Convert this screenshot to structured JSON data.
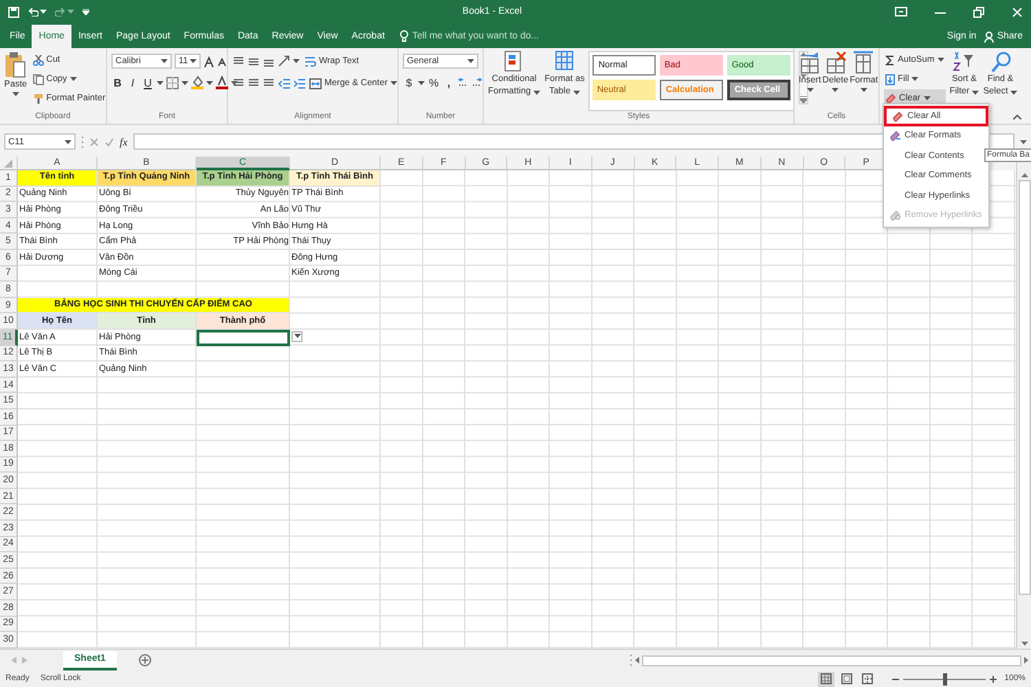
{
  "title_bar": {
    "title": "Book1 - Excel"
  },
  "tabs": [
    {
      "label": "File",
      "selected": false
    },
    {
      "label": "Home",
      "selected": true
    },
    {
      "label": "Insert",
      "selected": false
    },
    {
      "label": "Page Layout",
      "selected": false
    },
    {
      "label": "Formulas",
      "selected": false
    },
    {
      "label": "Data",
      "selected": false
    },
    {
      "label": "Review",
      "selected": false
    },
    {
      "label": "View",
      "selected": false
    },
    {
      "label": "Acrobat",
      "selected": false
    }
  ],
  "tell_me": {
    "placeholder": "Tell me what you want to do..."
  },
  "account": {
    "sign_in": "Sign in",
    "share": "Share"
  },
  "ribbon": {
    "clipboard": {
      "label": "Clipboard",
      "paste": "Paste",
      "cut": "Cut",
      "copy": "Copy",
      "format_painter": "Format Painter"
    },
    "font": {
      "label": "Font",
      "family": "Calibri",
      "size": "11",
      "bold": "B",
      "italic": "I",
      "underline": "U"
    },
    "alignment": {
      "label": "Alignment",
      "wrap_text": "Wrap Text",
      "merge": "Merge & Center"
    },
    "number": {
      "label": "Number",
      "format": "General",
      "currency": "$",
      "percent": "%",
      "comma": ","
    },
    "styles": {
      "label": "Styles",
      "conditional": [
        "Conditional",
        "Formatting"
      ],
      "format_table": [
        "Format as",
        "Table"
      ],
      "cell_styles": [
        {
          "name": "Normal",
          "kind": "normal"
        },
        {
          "name": "Bad",
          "kind": "bad"
        },
        {
          "name": "Good",
          "kind": "good"
        },
        {
          "name": "Neutral",
          "kind": "neutral"
        },
        {
          "name": "Calculation",
          "kind": "calculation"
        },
        {
          "name": "Check Cell",
          "kind": "check"
        }
      ]
    },
    "cells": {
      "label": "Cells",
      "buttons": [
        {
          "label": "Insert",
          "kind": "insert"
        },
        {
          "label": "Delete",
          "kind": "delete"
        },
        {
          "label": "Format",
          "kind": "format"
        }
      ]
    },
    "editing": {
      "autosum": "AutoSum",
      "fill": "Fill",
      "clear": {
        "label": "Clear",
        "expanded": true
      },
      "sort": [
        "Sort &",
        "Filter"
      ],
      "find": [
        "Find &",
        "Select"
      ]
    }
  },
  "formula_bar": {
    "name_box": "C11",
    "fx": "fx"
  },
  "sheet": {
    "columns": [
      {
        "label": "A",
        "selected": false
      },
      {
        "label": "B",
        "selected": false
      },
      {
        "label": "C",
        "selected": true
      },
      {
        "label": "D",
        "selected": false
      },
      {
        "label": "E",
        "selected": false
      },
      {
        "label": "F",
        "selected": false
      },
      {
        "label": "G",
        "selected": false
      },
      {
        "label": "H",
        "selected": false
      },
      {
        "label": "I",
        "selected": false
      },
      {
        "label": "J",
        "selected": false
      },
      {
        "label": "K",
        "selected": false
      },
      {
        "label": "L",
        "selected": false
      },
      {
        "label": "M",
        "selected": false
      },
      {
        "label": "N",
        "selected": false
      },
      {
        "label": "O",
        "selected": false
      },
      {
        "label": "P",
        "selected": false
      }
    ],
    "rows": [
      {
        "number": "1",
        "selected": false,
        "cells": {
          "a": {
            "text": "Tên tỉnh",
            "kind": "header",
            "color": "#ffff00"
          },
          "b": {
            "text": "T.p Tỉnh Quảng Ninh",
            "kind": "header",
            "color": "#ffd966"
          },
          "c": {
            "text": "T.p Tỉnh Hải Phòng",
            "kind": "header",
            "color": "#a9d08e"
          },
          "d": {
            "text": "T.p Tỉnh Thái Bình",
            "kind": "header",
            "color": "#fff2cc"
          }
        }
      },
      {
        "number": "2",
        "selected": false,
        "cells": {
          "a": {
            "text": "Quảng Ninh",
            "kind": "left"
          },
          "b": {
            "text": "Uông Bí",
            "kind": "left"
          },
          "c": {
            "text": "Thủy Nguyên",
            "kind": "right"
          },
          "d": {
            "text": "TP Thái Bình",
            "kind": "left"
          }
        }
      },
      {
        "number": "3",
        "selected": false,
        "cells": {
          "a": {
            "text": "Hải Phòng",
            "kind": "left"
          },
          "b": {
            "text": "Đông Triều",
            "kind": "left"
          },
          "c": {
            "text": "An Lão",
            "kind": "right"
          },
          "d": {
            "text": "Vũ Thư",
            "kind": "left"
          }
        }
      },
      {
        "number": "4",
        "selected": false,
        "cells": {
          "a": {
            "text": "Hải Phòng",
            "kind": "left"
          },
          "b": {
            "text": "Hạ Long",
            "kind": "left"
          },
          "c": {
            "text": "Vĩnh Bảo",
            "kind": "right"
          },
          "d": {
            "text": "Hưng Hà",
            "kind": "left"
          }
        }
      },
      {
        "number": "5",
        "selected": false,
        "cells": {
          "a": {
            "text": "Thái Bình",
            "kind": "left"
          },
          "b": {
            "text": "Cẩm Phả",
            "kind": "left"
          },
          "c": {
            "text": "TP Hải Phòng",
            "kind": "right"
          },
          "d": {
            "text": "Thái Thụy",
            "kind": "left"
          }
        }
      },
      {
        "number": "6",
        "selected": false,
        "cells": {
          "a": {
            "text": "Hải Dương",
            "kind": "left"
          },
          "b": {
            "text": "Vân Đồn",
            "kind": "left"
          },
          "d": {
            "text": "Đông Hưng",
            "kind": "left"
          }
        }
      },
      {
        "number": "7",
        "selected": false,
        "cells": {
          "b": {
            "text": "Móng Cái",
            "kind": "left"
          },
          "d": {
            "text": "Kiến Xương",
            "kind": "left"
          }
        }
      },
      {
        "number": "8",
        "selected": false
      },
      {
        "number": "9",
        "selected": false,
        "cells": {
          "a": {
            "text": "BẢNG HỌC SINH THI CHUYỂN CẤP ĐIỂM CAO",
            "kind": "title",
            "color": "#ffff00"
          }
        }
      },
      {
        "number": "10",
        "selected": false,
        "cells": {
          "a": {
            "text": "Họ Tên",
            "kind": "header",
            "color": "#d9e1f2"
          },
          "b": {
            "text": "Tỉnh",
            "kind": "header",
            "color": "#e2efda"
          },
          "c": {
            "text": "Thành phố",
            "kind": "header",
            "color": "#fce4d6"
          }
        }
      },
      {
        "number": "11",
        "selected": true,
        "cells": {
          "a": {
            "text": "Lê Văn A",
            "kind": "left"
          },
          "b": {
            "text": "Hải Phòng",
            "kind": "left"
          },
          "c": {
            "kind": "empty",
            "selected": true,
            "has_list": true
          }
        }
      },
      {
        "number": "12",
        "selected": false,
        "cells": {
          "a": {
            "text": "Lê Thị B",
            "kind": "left"
          },
          "b": {
            "text": "Thái Bình",
            "kind": "left"
          }
        }
      },
      {
        "number": "13",
        "selected": false,
        "cells": {
          "a": {
            "text": "Lê Văn C",
            "kind": "left"
          },
          "b": {
            "text": "Quảng Ninh",
            "kind": "left"
          }
        }
      },
      {
        "number": "14",
        "selected": false
      },
      {
        "number": "15",
        "selected": false
      },
      {
        "number": "16",
        "selected": false
      },
      {
        "number": "17",
        "selected": false
      },
      {
        "number": "18",
        "selected": false
      },
      {
        "number": "19",
        "selected": false
      },
      {
        "number": "20",
        "selected": false
      },
      {
        "number": "21",
        "selected": false
      },
      {
        "number": "22",
        "selected": false
      },
      {
        "number": "23",
        "selected": false
      },
      {
        "number": "24",
        "selected": false
      },
      {
        "number": "25",
        "selected": false
      },
      {
        "number": "26",
        "selected": false
      },
      {
        "number": "27",
        "selected": false
      },
      {
        "number": "28",
        "selected": false
      },
      {
        "number": "29",
        "selected": false
      },
      {
        "number": "30",
        "selected": false
      }
    ]
  },
  "clear_menu": {
    "items": [
      {
        "label": "Clear All",
        "kind": "eraser",
        "selected": true,
        "disabled": false
      },
      {
        "label": "Clear Formats",
        "kind": "formats",
        "selected": false,
        "disabled": false
      },
      {
        "label": "Clear Contents",
        "kind": "plain",
        "selected": false,
        "disabled": false
      },
      {
        "label": "Clear Comments",
        "kind": "plain",
        "selected": false,
        "disabled": false
      },
      {
        "label": "Clear Hyperlinks",
        "kind": "plain",
        "selected": false,
        "disabled": false
      },
      {
        "label": "Remove Hyperlinks",
        "kind": "hyperlink",
        "selected": false,
        "disabled": true
      }
    ]
  },
  "tooltip": {
    "text": "Formula Ba"
  },
  "sheet_tabs": [
    {
      "label": "Sheet1",
      "selected": true
    }
  ],
  "status_bar": {
    "ready": "Ready",
    "scroll_lock": "Scroll Lock",
    "views": [
      {
        "kind": "normal",
        "selected": true
      },
      {
        "kind": "page_layout",
        "selected": false
      },
      {
        "kind": "page_break",
        "selected": false
      }
    ],
    "zoom_slider": {
      "level": 0.5
    },
    "zoom": "100%"
  }
}
